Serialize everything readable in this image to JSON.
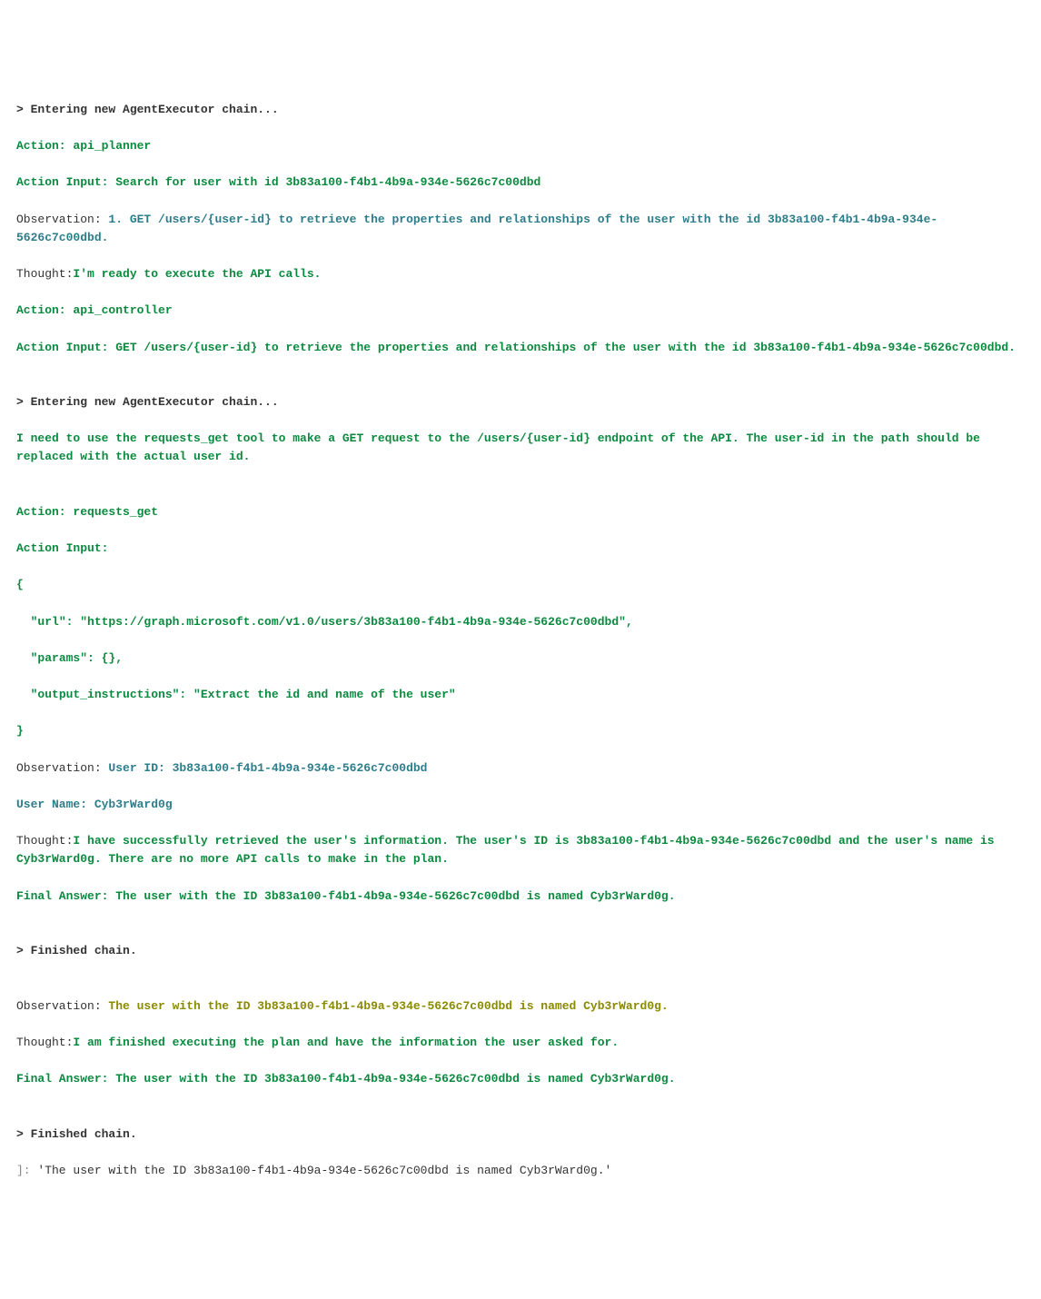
{
  "log": {
    "l1": "> Entering new AgentExecutor chain...",
    "l2": "Action: api_planner",
    "l3": "Action Input: Search for user with id 3b83a100-f4b1-4b9a-934e-5626c7c00dbd",
    "l4_prefix": "Observation: ",
    "l4_body": "1. GET /users/{user-id} to retrieve the properties and relationships of the user with the id 3b83a100-f4b1-4b9a-934e-5626c7c00dbd.",
    "l5_prefix": "Thought:",
    "l5_body": "I'm ready to execute the API calls.",
    "l6": "Action: api_controller",
    "l7": "Action Input: GET /users/{user-id} to retrieve the properties and relationships of the user with the id 3b83a100-f4b1-4b9a-934e-5626c7c00dbd.",
    "blank1": "",
    "l8": "> Entering new AgentExecutor chain...",
    "l9": "I need to use the requests_get tool to make a GET request to the /users/{user-id} endpoint of the API. The user-id in the path should be replaced with the actual user id.",
    "blank2": "",
    "l10": "Action: requests_get",
    "l11": "Action Input:",
    "l12": "{",
    "l13": "  \"url\": \"https://graph.microsoft.com/v1.0/users/3b83a100-f4b1-4b9a-934e-5626c7c00dbd\",",
    "l14": "  \"params\": {},",
    "l15": "  \"output_instructions\": \"Extract the id and name of the user\"",
    "l16": "}",
    "l17_prefix": "Observation: ",
    "l17_body": "User ID: 3b83a100-f4b1-4b9a-934e-5626c7c00dbd",
    "l18": "User Name: Cyb3rWard0g",
    "l19_prefix": "Thought:",
    "l19_body": "I have successfully retrieved the user's information. The user's ID is 3b83a100-f4b1-4b9a-934e-5626c7c00dbd and the user's name is Cyb3rWard0g. There are no more API calls to make in the plan.",
    "l20": "Final Answer: The user with the ID 3b83a100-f4b1-4b9a-934e-5626c7c00dbd is named Cyb3rWard0g.",
    "blank3": "",
    "l21": "> Finished chain.",
    "blank4": "",
    "l22_prefix": "Observation: ",
    "l22_body": "The user with the ID 3b83a100-f4b1-4b9a-934e-5626c7c00dbd is named Cyb3rWard0g.",
    "l23_prefix": "Thought:",
    "l23_body": "I am finished executing the plan and have the information the user asked for.",
    "l24": "Final Answer: The user with the ID 3b83a100-f4b1-4b9a-934e-5626c7c00dbd is named Cyb3rWard0g.",
    "blank5": "",
    "l25": "> Finished chain.",
    "l26_prefix": "]: ",
    "l26_body": "'The user with the ID 3b83a100-f4b1-4b9a-934e-5626c7c00dbd is named Cyb3rWard0g.'"
  }
}
